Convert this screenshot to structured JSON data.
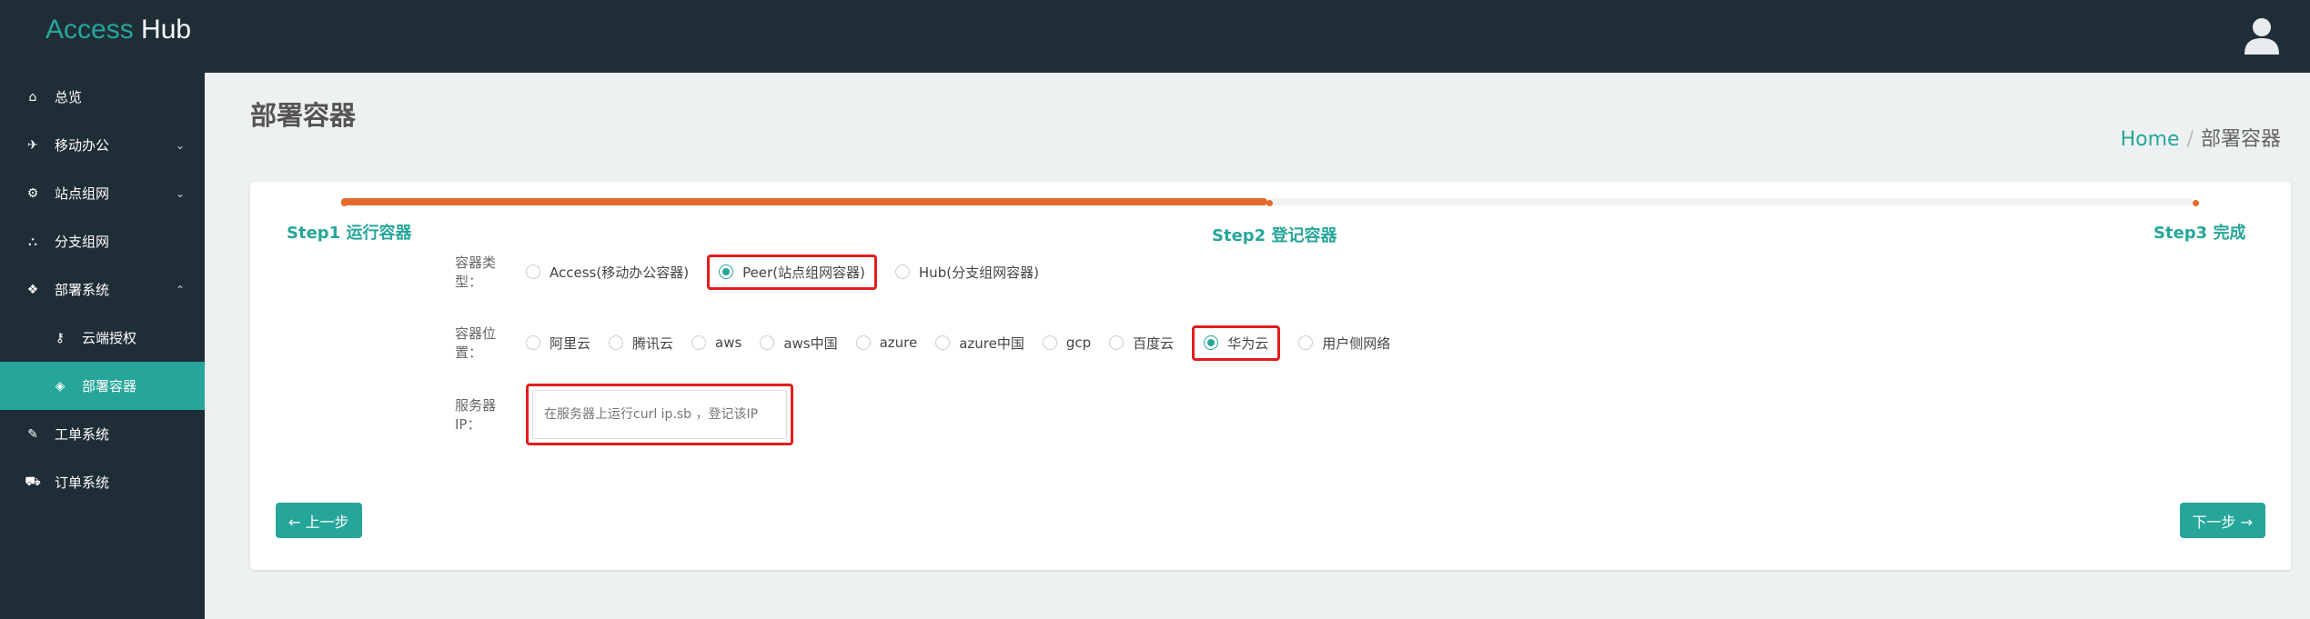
{
  "app": {
    "brand_part1": "Access",
    "brand_part2": "Hub"
  },
  "sidebar": {
    "items": [
      {
        "label": "总览",
        "icon": "home-icon",
        "glyph": "⌂"
      },
      {
        "label": "移动办公",
        "icon": "plane-icon",
        "glyph": "✈",
        "chevron": "⌄"
      },
      {
        "label": "站点组网",
        "icon": "network-icon",
        "glyph": "⚙",
        "chevron": "⌄"
      },
      {
        "label": "分支组网",
        "icon": "sitemap-icon",
        "glyph": "⛬"
      },
      {
        "label": "部署系统",
        "icon": "cubes-icon",
        "glyph": "❖",
        "chevron": "⌃"
      },
      {
        "label": "云端授权",
        "icon": "key-icon",
        "glyph": "⚷"
      },
      {
        "label": "部署容器",
        "icon": "cube-icon",
        "glyph": "◈"
      },
      {
        "label": "工单系统",
        "icon": "wrench-icon",
        "glyph": "✎"
      },
      {
        "label": "订单系统",
        "icon": "cart-icon",
        "glyph": "⛟"
      }
    ]
  },
  "page": {
    "title": "部署容器"
  },
  "breadcrumb": {
    "home": "Home",
    "separator": "/",
    "current": "部署容器"
  },
  "wizard": {
    "progress": 0.5,
    "steps": [
      "Step1 运行容器",
      "Step2 登记容器",
      "Step3 完成"
    ]
  },
  "form": {
    "type_label": "容器类型：",
    "type_options": [
      "Access(移动办公容器)",
      "Peer(站点组网容器)",
      "Hub(分支组网容器)"
    ],
    "type_selected": 1,
    "location_label": "容器位置：",
    "location_options": [
      "阿里云",
      "腾讯云",
      "aws",
      "aws中国",
      "azure",
      "azure中国",
      "gcp",
      "百度云",
      "华为云",
      "用户侧网络"
    ],
    "location_selected": 8,
    "ip_label": "服务器IP：",
    "ip_placeholder": "在服务器上运行curl ip.sb ，登记该IP",
    "ip_value": ""
  },
  "buttons": {
    "prev": "← 上一步",
    "next": "下一步 →"
  },
  "colors": {
    "accent": "#26a69a",
    "progress": "#e46b2d",
    "highlight": "#e21d1d",
    "sidebar": "#1f2d36"
  }
}
